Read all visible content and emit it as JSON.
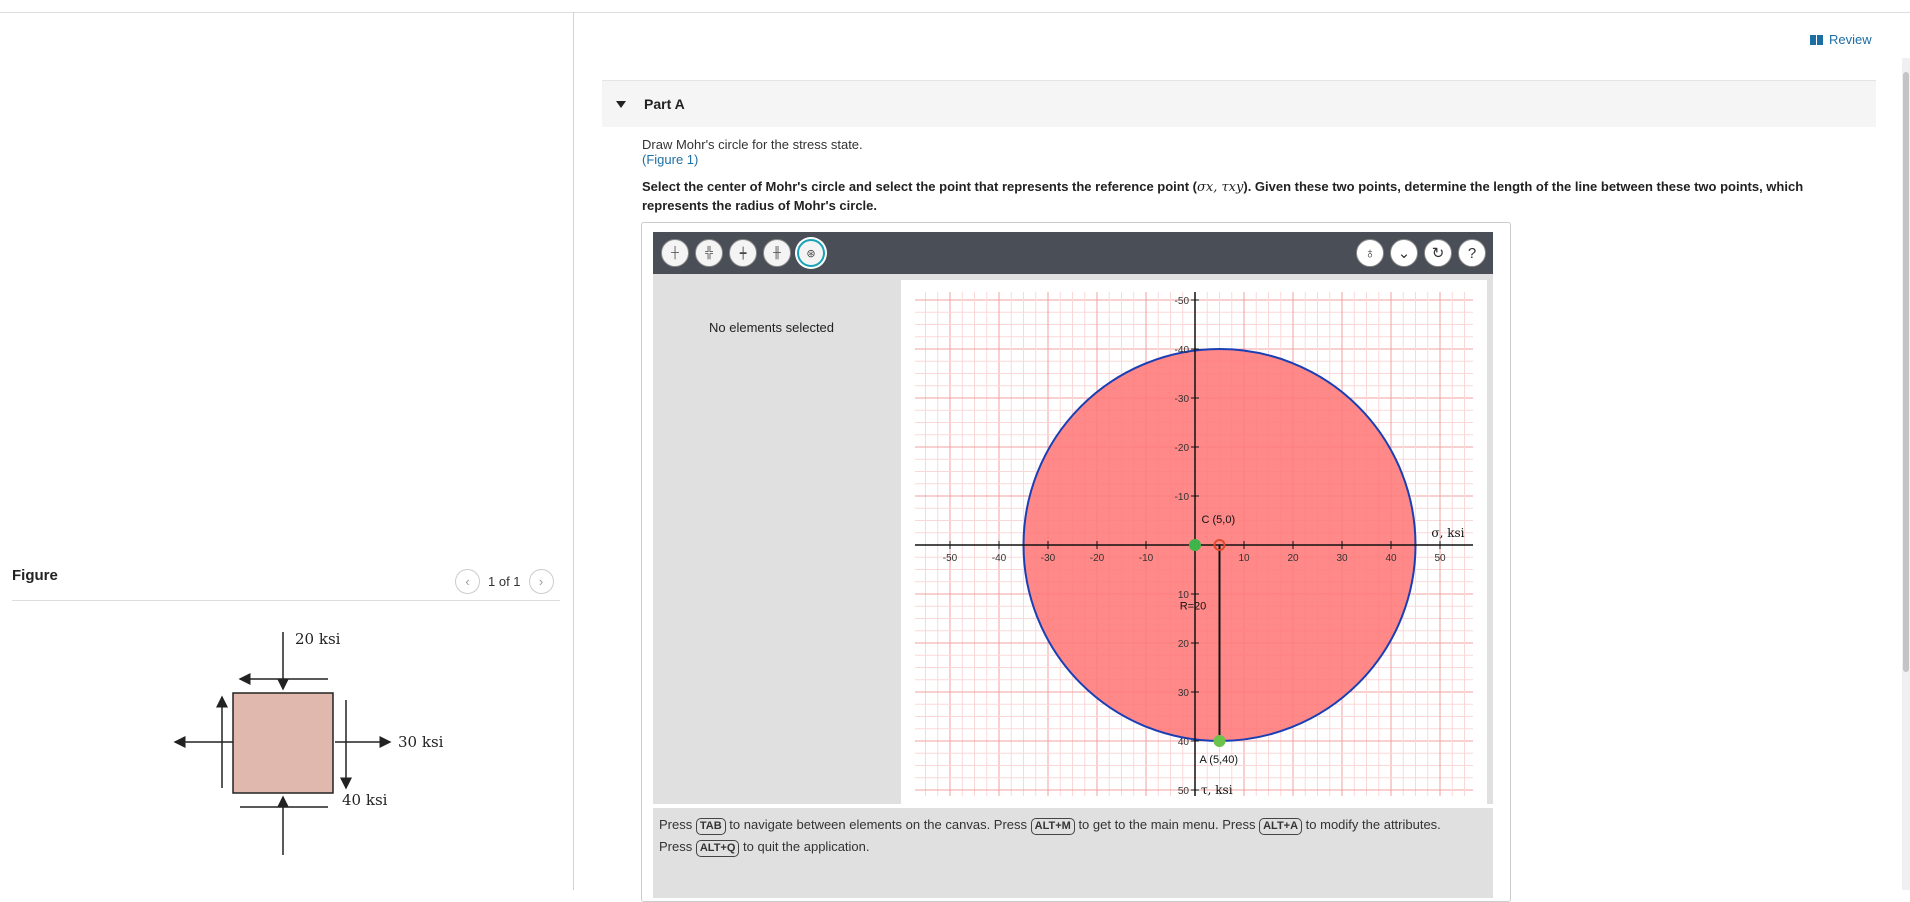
{
  "review": {
    "label": "Review"
  },
  "figure": {
    "title": "Figure",
    "page": "1 of 1",
    "prev_icon": "chevron-left-icon",
    "next_icon": "chevron-right-icon",
    "labels": {
      "top": "20 ksi",
      "right": "30 ksi",
      "bottom": "40 ksi"
    },
    "element_color": "#e0b8ae"
  },
  "part": {
    "title": "Part A",
    "prompt": "Draw Mohr's circle for the stress state.",
    "figure_link": "(Figure 1)",
    "instruction_pre": "Select the center of Mohr's circle and select the point that represents the reference point (",
    "instruction_math": "σx, τxy",
    "instruction_post": "). Given these two points, determine the length of the line between these two points, which represents the radius of Mohr's circle."
  },
  "toolbar": {
    "left_tools": [
      "point-tool-icon",
      "circle-tool-icon",
      "center-point-tool-icon",
      "line-tool-icon",
      "radius-tool-icon"
    ],
    "right_tools": [
      "hint-bulb-icon",
      "chevron-down-icon",
      "reset-icon",
      "help-icon"
    ]
  },
  "side_panel": {
    "status": "No elements selected"
  },
  "chart_data": {
    "type": "scatter",
    "x_axis": {
      "label": "σ, ksi",
      "range": [
        -55,
        55
      ],
      "ticks": [
        -50,
        -40,
        -30,
        -20,
        -10,
        10,
        20,
        30,
        40,
        50
      ]
    },
    "y_axis": {
      "label": "τ, ksi",
      "range": [
        -50,
        50
      ],
      "ticks": [
        -50,
        -40,
        -30,
        -20,
        -10,
        10,
        20,
        30,
        40,
        50
      ],
      "direction": "down-positive"
    },
    "grid": true,
    "circle": {
      "center": [
        5,
        0
      ],
      "radius": 40,
      "fill": "#ff7b7b",
      "stroke": "#1a3fb5"
    },
    "points": [
      {
        "label": "C (5,0)",
        "x": 5,
        "y": 0,
        "color": "#e24a2b"
      },
      {
        "label": "A (5,40)",
        "x": 5,
        "y": 40,
        "color": "#6cc24a"
      },
      {
        "label": "",
        "x": 0,
        "y": 0,
        "color": "#3cb54a"
      }
    ],
    "segment": {
      "from": [
        5,
        0
      ],
      "to": [
        5,
        40
      ],
      "label": "R=20"
    }
  },
  "help": {
    "p1": "Press",
    "k1": "TAB",
    "t1": "to navigate between elements on the canvas. Press",
    "k2": "ALT+M",
    "t2": "to get to the main menu. Press",
    "k3": "ALT+A",
    "t3": "to modify the attributes.",
    "p2": "Press",
    "k4": "ALT+Q",
    "t4": "to quit the application."
  }
}
